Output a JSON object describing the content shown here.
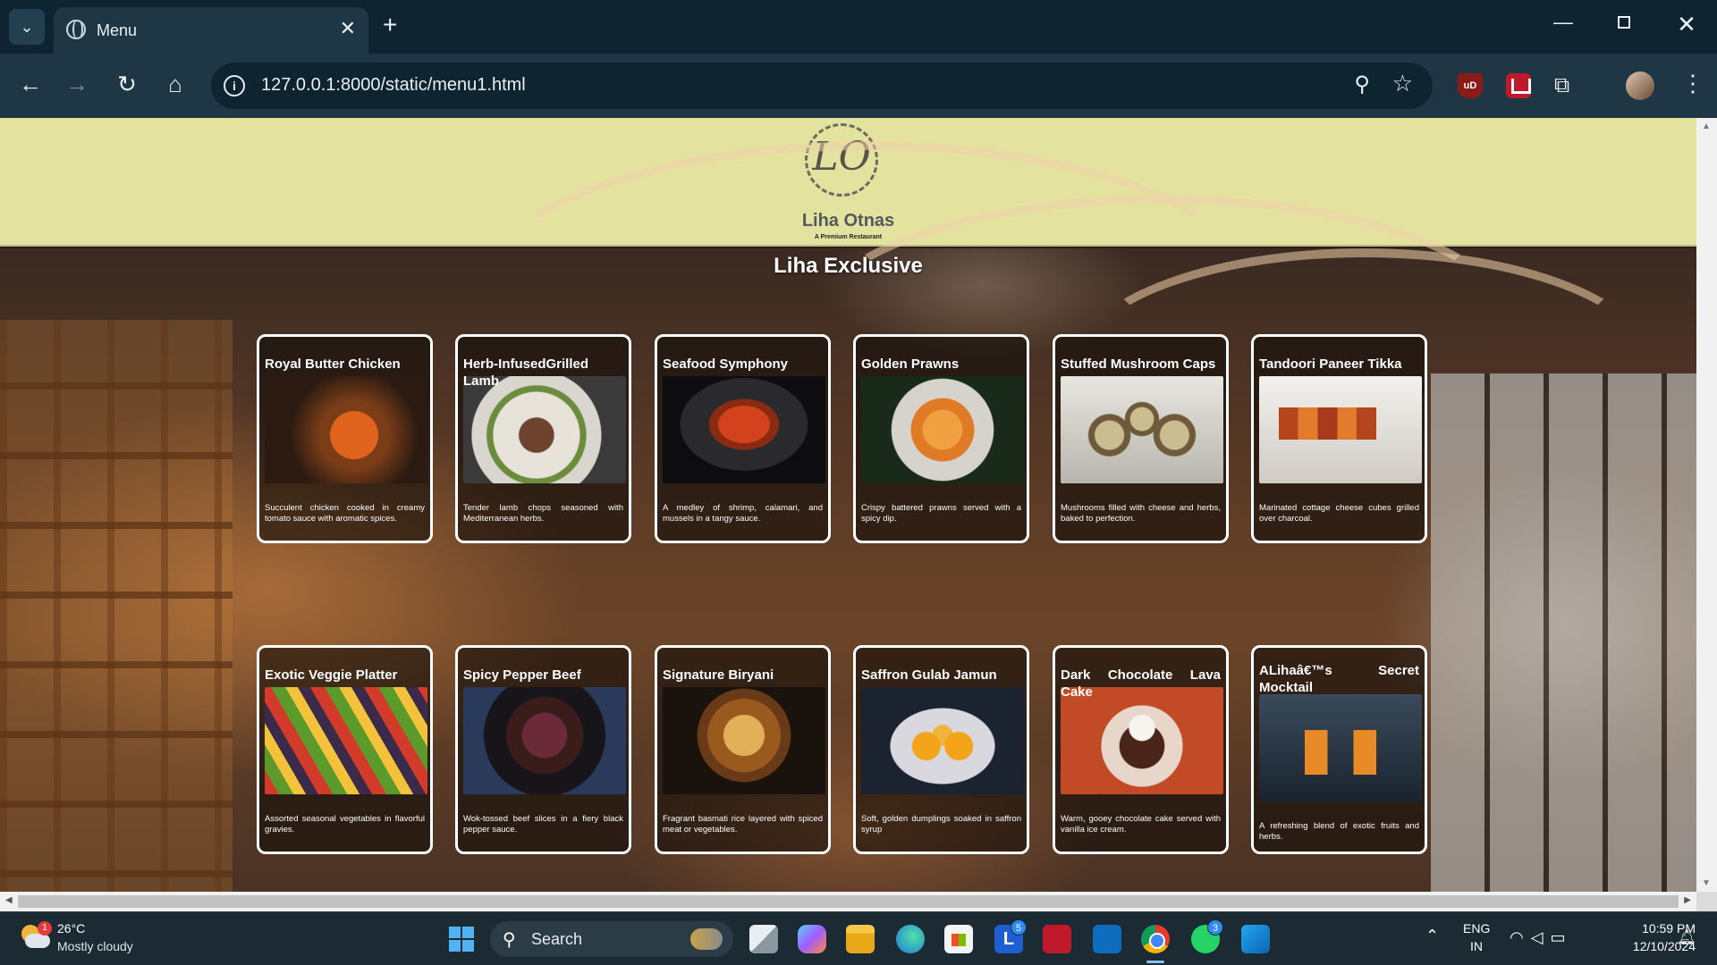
{
  "browser": {
    "tab_title": "Menu",
    "url": "127.0.0.1:8000/static/menu1.html",
    "extensions": {
      "ublock_label": "uD"
    }
  },
  "site": {
    "logo_letters": "LO",
    "brand_name": "Liha Otnas",
    "tagline": "A Premium Restaurant",
    "section_title": "Liha Exclusive"
  },
  "menu": {
    "items": [
      {
        "name": "Royal Butter Chicken",
        "desc": "Succulent chicken cooked in creamy tomato sauce with aromatic spices.",
        "image": "butter-chicken"
      },
      {
        "name": "Herb-InfusedGrilled Lamb",
        "desc": "Tender lamb chops seasoned with Mediterranean herbs.",
        "image": "grilled-lamb"
      },
      {
        "name": "Seafood Symphony",
        "desc": "A medley of shrimp, calamari, and mussels in a tangy sauce.",
        "image": "seafood"
      },
      {
        "name": "Golden Prawns",
        "desc": "Crispy battered prawns served with a spicy dip.",
        "image": "prawns"
      },
      {
        "name": "Stuffed Mushroom Caps",
        "desc": "Mushrooms filled with cheese and herbs, baked to perfection.",
        "image": "mushroom-caps"
      },
      {
        "name": "Tandoori Paneer Tikka",
        "desc": "Marinated cottage cheese cubes grilled over charcoal.",
        "image": "paneer-tikka"
      },
      {
        "name": "Exotic Veggie Platter",
        "desc": "Assorted seasonal vegetables in flavorful gravies.",
        "image": "veggie-platter"
      },
      {
        "name": "Spicy Pepper Beef",
        "desc": "Wok-tossed beef slices in a fiery black pepper sauce.",
        "image": "pepper-beef"
      },
      {
        "name": "Signature Biryani",
        "desc": "Fragrant basmati rice layered with spiced meat or vegetables.",
        "image": "biryani"
      },
      {
        "name": "Saffron Gulab Jamun",
        "desc": "Soft, golden dumplings soaked in saffron syrup",
        "image": "gulab-jamun"
      },
      {
        "name": "Dark Chocolate Lava Cake",
        "desc": "Warm, gooey chocolate cake served with vanilla ice cream.",
        "image": "lava-cake"
      },
      {
        "name": "ALihaâ€™s Secret Mocktail",
        "desc": "A refreshing blend of exotic fruits and herbs.",
        "image": "mocktail"
      }
    ]
  },
  "taskbar": {
    "weather_temp": "26°C",
    "weather_desc": "Mostly cloudy",
    "weather_badge": "1",
    "search_label": "Search",
    "lens_badge": "5",
    "whatsapp_badge": "3",
    "lang_line1": "ENG",
    "lang_line2": "IN",
    "time": "10:59 PM",
    "date": "12/10/2024"
  },
  "colors": {
    "header_bg": "#e3e39f",
    "card_border": "#ffffff",
    "browser_bg": "#1f3745",
    "taskbar_bg": "#1c2a34"
  }
}
